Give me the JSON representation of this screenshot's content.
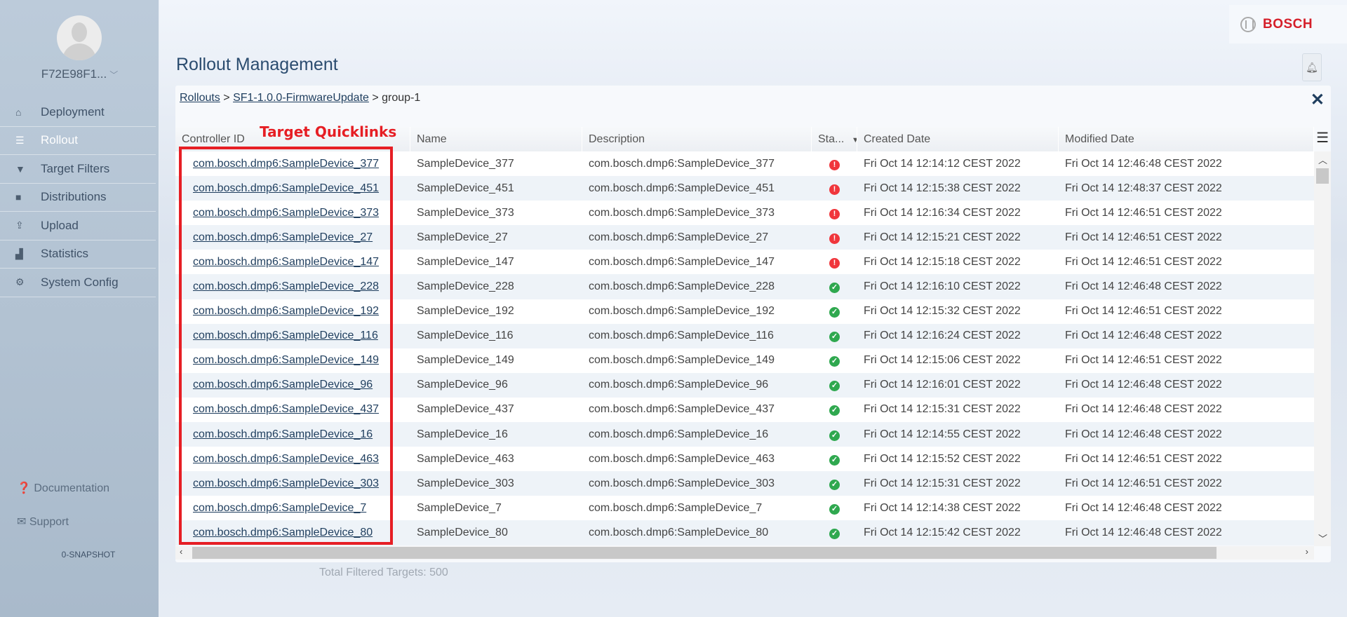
{
  "sidebar": {
    "user": "F72E98F1...",
    "items": [
      {
        "label": "Deployment",
        "icon": "home-icon",
        "glyph": "⌂",
        "active": false
      },
      {
        "label": "Rollout",
        "icon": "list-icon",
        "glyph": "☰",
        "active": true
      },
      {
        "label": "Target Filters",
        "icon": "filter-icon",
        "glyph": "▼",
        "active": false
      },
      {
        "label": "Distributions",
        "icon": "briefcase-icon",
        "glyph": "■",
        "active": false
      },
      {
        "label": "Upload",
        "icon": "upload-icon",
        "glyph": "⇪",
        "active": false
      },
      {
        "label": "Statistics",
        "icon": "bar-chart-icon",
        "glyph": "▟",
        "active": false
      },
      {
        "label": "System Config",
        "icon": "gear-icon",
        "glyph": "⚙",
        "active": false
      }
    ],
    "documentation": "Documentation",
    "support": "Support",
    "version": "0-SNAPSHOT"
  },
  "brand": "BOSCH",
  "title": "Rollout Management",
  "breadcrumb": {
    "rollouts": "Rollouts",
    "rollout": "SF1-1.0.0-FirmwareUpdate",
    "group": "group-1",
    "sep": ">"
  },
  "table": {
    "columns": [
      "Controller ID",
      "Name",
      "Description",
      "Sta...",
      "Created Date",
      "Modified Date"
    ],
    "rows": [
      [
        "com.bosch.dmp6:SampleDevice_377",
        "SampleDevice_377",
        "com.bosch.dmp6:SampleDevice_377",
        "error",
        "Fri Oct 14 12:14:12 CEST 2022",
        "Fri Oct 14 12:46:48 CEST 2022"
      ],
      [
        "com.bosch.dmp6:SampleDevice_451",
        "SampleDevice_451",
        "com.bosch.dmp6:SampleDevice_451",
        "error",
        "Fri Oct 14 12:15:38 CEST 2022",
        "Fri Oct 14 12:48:37 CEST 2022"
      ],
      [
        "com.bosch.dmp6:SampleDevice_373",
        "SampleDevice_373",
        "com.bosch.dmp6:SampleDevice_373",
        "error",
        "Fri Oct 14 12:16:34 CEST 2022",
        "Fri Oct 14 12:46:51 CEST 2022"
      ],
      [
        "com.bosch.dmp6:SampleDevice_27",
        "SampleDevice_27",
        "com.bosch.dmp6:SampleDevice_27",
        "error",
        "Fri Oct 14 12:15:21 CEST 2022",
        "Fri Oct 14 12:46:51 CEST 2022"
      ],
      [
        "com.bosch.dmp6:SampleDevice_147",
        "SampleDevice_147",
        "com.bosch.dmp6:SampleDevice_147",
        "error",
        "Fri Oct 14 12:15:18 CEST 2022",
        "Fri Oct 14 12:46:51 CEST 2022"
      ],
      [
        "com.bosch.dmp6:SampleDevice_228",
        "SampleDevice_228",
        "com.bosch.dmp6:SampleDevice_228",
        "ok",
        "Fri Oct 14 12:16:10 CEST 2022",
        "Fri Oct 14 12:46:48 CEST 2022"
      ],
      [
        "com.bosch.dmp6:SampleDevice_192",
        "SampleDevice_192",
        "com.bosch.dmp6:SampleDevice_192",
        "ok",
        "Fri Oct 14 12:15:32 CEST 2022",
        "Fri Oct 14 12:46:51 CEST 2022"
      ],
      [
        "com.bosch.dmp6:SampleDevice_116",
        "SampleDevice_116",
        "com.bosch.dmp6:SampleDevice_116",
        "ok",
        "Fri Oct 14 12:16:24 CEST 2022",
        "Fri Oct 14 12:46:48 CEST 2022"
      ],
      [
        "com.bosch.dmp6:SampleDevice_149",
        "SampleDevice_149",
        "com.bosch.dmp6:SampleDevice_149",
        "ok",
        "Fri Oct 14 12:15:06 CEST 2022",
        "Fri Oct 14 12:46:51 CEST 2022"
      ],
      [
        "com.bosch.dmp6:SampleDevice_96",
        "SampleDevice_96",
        "com.bosch.dmp6:SampleDevice_96",
        "ok",
        "Fri Oct 14 12:16:01 CEST 2022",
        "Fri Oct 14 12:46:48 CEST 2022"
      ],
      [
        "com.bosch.dmp6:SampleDevice_437",
        "SampleDevice_437",
        "com.bosch.dmp6:SampleDevice_437",
        "ok",
        "Fri Oct 14 12:15:31 CEST 2022",
        "Fri Oct 14 12:46:48 CEST 2022"
      ],
      [
        "com.bosch.dmp6:SampleDevice_16",
        "SampleDevice_16",
        "com.bosch.dmp6:SampleDevice_16",
        "ok",
        "Fri Oct 14 12:14:55 CEST 2022",
        "Fri Oct 14 12:46:48 CEST 2022"
      ],
      [
        "com.bosch.dmp6:SampleDevice_463",
        "SampleDevice_463",
        "com.bosch.dmp6:SampleDevice_463",
        "ok",
        "Fri Oct 14 12:15:52 CEST 2022",
        "Fri Oct 14 12:46:51 CEST 2022"
      ],
      [
        "com.bosch.dmp6:SampleDevice_303",
        "SampleDevice_303",
        "com.bosch.dmp6:SampleDevice_303",
        "ok",
        "Fri Oct 14 12:15:31 CEST 2022",
        "Fri Oct 14 12:46:51 CEST 2022"
      ],
      [
        "com.bosch.dmp6:SampleDevice_7",
        "SampleDevice_7",
        "com.bosch.dmp6:SampleDevice_7",
        "ok",
        "Fri Oct 14 12:14:38 CEST 2022",
        "Fri Oct 14 12:46:48 CEST 2022"
      ],
      [
        "com.bosch.dmp6:SampleDevice_80",
        "SampleDevice_80",
        "com.bosch.dmp6:SampleDevice_80",
        "ok",
        "Fri Oct 14 12:15:42 CEST 2022",
        "Fri Oct 14 12:46:48 CEST 2022"
      ]
    ]
  },
  "status_colors": {
    "error": "#f0363c",
    "ok": "#2fa84f"
  },
  "annotation": "Target Quicklinks",
  "total": "Total Filtered Targets: 500"
}
